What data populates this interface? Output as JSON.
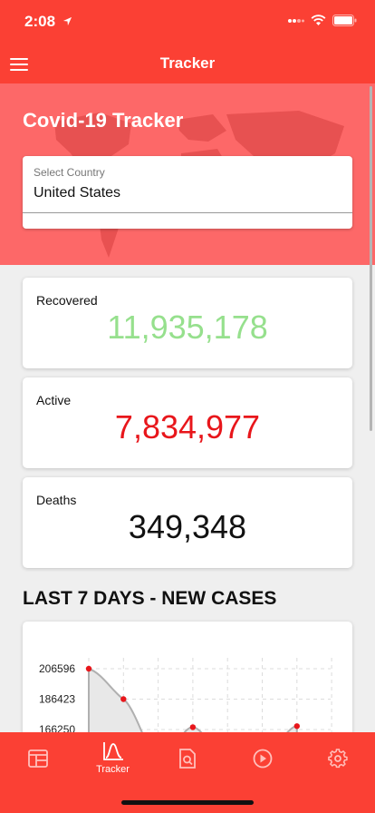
{
  "status": {
    "time": "2:08"
  },
  "nav": {
    "title": "Tracker"
  },
  "hero": {
    "title": "Covid-19 Tracker",
    "select_label": "Select Country",
    "select_value": "United States"
  },
  "cards": {
    "recovered": {
      "label": "Recovered",
      "value": "11,935,178",
      "color": "#96e08d"
    },
    "active": {
      "label": "Active",
      "value": "7,834,977",
      "color": "#e8161b"
    },
    "deaths": {
      "label": "Deaths",
      "value": "349,348",
      "color": "#111111"
    }
  },
  "section": {
    "title": "LAST 7 DAYS - NEW CASES"
  },
  "chart_data": {
    "type": "area",
    "title": "LAST 7 DAYS - NEW CASES",
    "y_ticks": [
      "206596",
      "186423",
      "166250"
    ],
    "points": [
      206596,
      186423,
      null,
      167800,
      null,
      null,
      168500
    ],
    "marker_color": "#e8161b"
  },
  "tabs": [
    {
      "name": "tab-dashboard",
      "icon": "dashboard-icon",
      "label": ""
    },
    {
      "name": "tab-tracker",
      "icon": "chart-icon",
      "label": "Tracker"
    },
    {
      "name": "tab-search",
      "icon": "document-search-icon",
      "label": ""
    },
    {
      "name": "tab-video",
      "icon": "play-icon",
      "label": ""
    },
    {
      "name": "tab-settings",
      "icon": "gear-icon",
      "label": ""
    }
  ]
}
